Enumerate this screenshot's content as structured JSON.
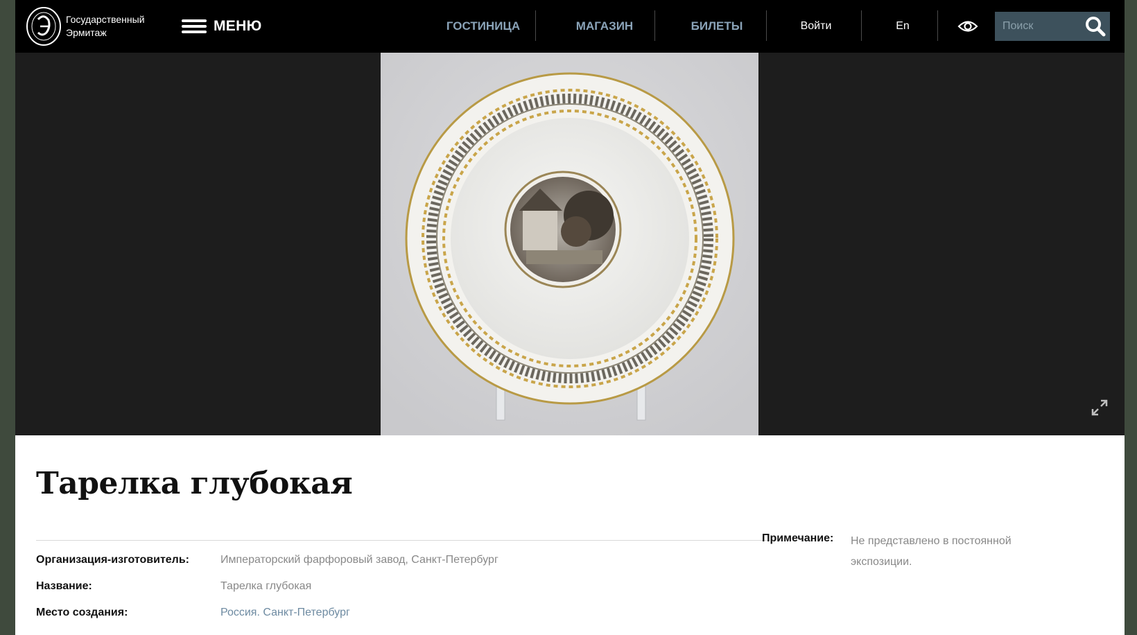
{
  "header": {
    "logo_line1": "Государственный",
    "logo_line2": "Эрмитаж",
    "menu_label": "МЕНЮ",
    "nav": [
      "ГОСТИНИЦА",
      "МАГАЗИН",
      "БИЛЕТЫ"
    ],
    "login_label": "Войти",
    "lang_label": "En",
    "search_placeholder": "Поиск",
    "icons": [
      "hermitage-logo-icon",
      "menu-icon",
      "eye-icon",
      "search-icon"
    ]
  },
  "viewer": {
    "image_subject": "plate-photo",
    "icons": [
      "expand-icon"
    ]
  },
  "item": {
    "title": "Тарелка глубокая",
    "fields": [
      {
        "key": "Организация-изготовитель:",
        "value": "Императорский фарфоровый завод, Санкт-Петербург"
      },
      {
        "key": "Название:",
        "value": "Тарелка глубокая"
      },
      {
        "key": "Место создания:",
        "value": "Россия. Санкт-Петербург"
      }
    ],
    "note_label": "Примечание:",
    "note_value": "Не представлено в постоянной экспозиции."
  },
  "colors": {
    "header_bg": "#000000",
    "nav_accent": "#8aa3b8",
    "search_bg": "#3d515c",
    "viewer_bg": "#1d1d1d",
    "link": "#6d8aa1"
  }
}
